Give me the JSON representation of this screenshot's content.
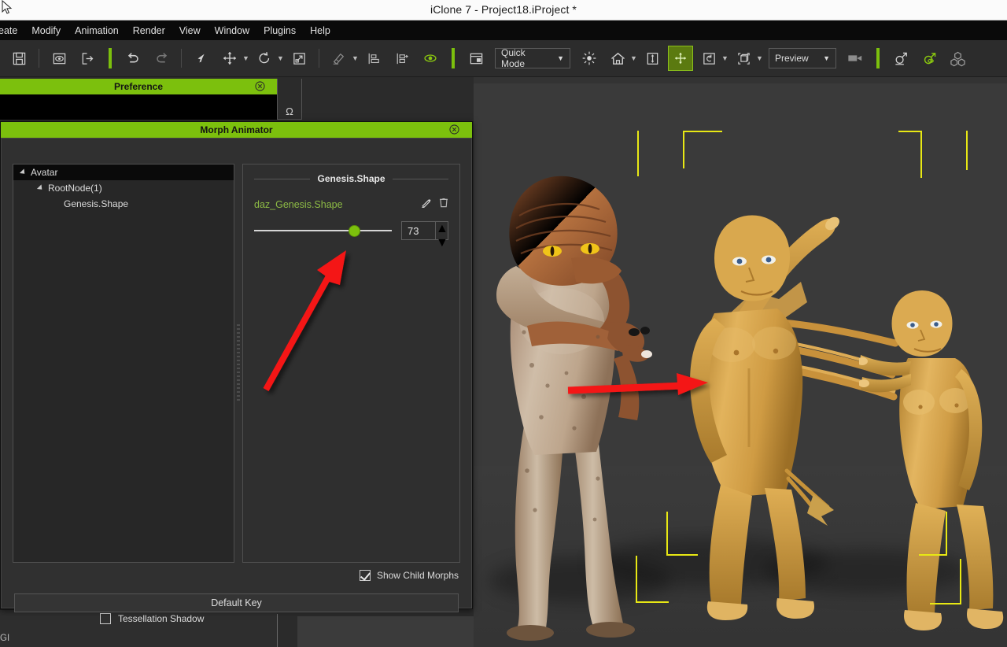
{
  "window": {
    "title": "iClone 7 - Project18.iProject *"
  },
  "menubar": {
    "items": [
      {
        "label": "eate"
      },
      {
        "label": "Modify"
      },
      {
        "label": "Animation"
      },
      {
        "label": "Render"
      },
      {
        "label": "View"
      },
      {
        "label": "Window"
      },
      {
        "label": "Plugins"
      },
      {
        "label": "Help"
      }
    ]
  },
  "toolbar": {
    "groups": [
      {
        "buttons": [
          {
            "icon": "save-icon",
            "name": "save-button"
          }
        ]
      },
      {
        "buttons": [
          {
            "icon": "preview-render-icon",
            "name": "preview-render-button"
          },
          {
            "icon": "export-icon",
            "name": "export-button"
          }
        ]
      },
      {
        "buttons": [
          {
            "icon": "undo-icon",
            "name": "undo-button"
          },
          {
            "icon": "redo-icon",
            "name": "redo-button"
          }
        ]
      },
      {
        "buttons": [
          {
            "icon": "select-arrow-icon",
            "name": "select-tool-button"
          },
          {
            "icon": "move-icon",
            "name": "move-tool-button",
            "caret": true
          },
          {
            "icon": "rotate-icon",
            "name": "rotate-tool-button",
            "caret": true
          },
          {
            "icon": "scale-icon",
            "name": "scale-tool-button"
          }
        ]
      },
      {
        "buttons": [
          {
            "icon": "edit-motion-icon",
            "name": "edit-motion-button",
            "caret": true
          },
          {
            "icon": "align-bottom-icon",
            "name": "align-button"
          },
          {
            "icon": "align-transfer-icon",
            "name": "transfer-button"
          },
          {
            "icon": "eye-icon",
            "name": "visibility-button"
          }
        ]
      },
      {
        "buttons": [
          {
            "icon": "layout-icon",
            "name": "layout-button"
          }
        ]
      }
    ],
    "quick_mode_label": "Quick Mode",
    "preview_label": "Preview",
    "right_buttons": [
      {
        "icon": "light-icon",
        "name": "light-button"
      },
      {
        "icon": "home-icon",
        "name": "home-button",
        "caret": true
      },
      {
        "icon": "ground-icon",
        "name": "ground-button"
      },
      {
        "icon": "move-grid-icon",
        "name": "move-grid-button",
        "active": true
      },
      {
        "icon": "physics-icon",
        "name": "physics-button",
        "caret": true
      },
      {
        "icon": "bounding-box-icon",
        "name": "bounding-box-button",
        "caret": true
      }
    ],
    "camera_icon": "camera-icon",
    "tail_buttons": [
      {
        "icon": "avatar-gender-icon",
        "name": "character-button"
      },
      {
        "icon": "morph-avatar-icon",
        "name": "morph-button"
      },
      {
        "icon": "props-cubes-icon",
        "name": "props-button"
      }
    ]
  },
  "preference_panel": {
    "title": "Preference",
    "close_icon": "close-circle-icon"
  },
  "side_strip": {
    "glyph": "Ω"
  },
  "morph_animator": {
    "title": "Morph Animator",
    "close_icon": "close-circle-icon",
    "tree": [
      {
        "label": "Avatar",
        "depth": 1,
        "expander": true,
        "selected": true
      },
      {
        "label": "RootNode(1)",
        "depth": 2,
        "expander": true,
        "selected": false
      },
      {
        "label": "Genesis.Shape",
        "depth": 3,
        "expander": false,
        "selected": false
      }
    ],
    "group_label": "Genesis.Shape",
    "morph": {
      "name": "daz_Genesis.Shape",
      "edit_icon": "pencil-icon",
      "delete_icon": "trash-icon",
      "value": "73",
      "slider_percent": 73,
      "spin_up": "▲",
      "spin_down": "▼"
    },
    "show_child_morphs": {
      "label": "Show Child Morphs",
      "checked": true
    },
    "default_key_label": "Default Key"
  },
  "lower_panel": {
    "tessellation_shadow": {
      "label": "Tessellation Shadow",
      "checked": false
    },
    "gi_label": "GI"
  },
  "viewport": {
    "background_color": "#3a3a3a",
    "selection_color": "#e8e814",
    "annotation_color": "#f41414",
    "figures": [
      {
        "name": "reptile-avatar",
        "tone": "#b08a6e"
      },
      {
        "name": "gold-male-avatar",
        "tone": "#d9a74e"
      },
      {
        "name": "gold-female-avatar",
        "tone": "#dcab58"
      }
    ],
    "annotations": [
      {
        "name": "arrow-to-slider",
        "direction": "up-right"
      },
      {
        "name": "arrow-to-avatar",
        "direction": "right"
      }
    ]
  },
  "colors": {
    "accent_green": "#7cc00d",
    "panel_bg": "#2f2f2f",
    "toolbar_bg": "#2c2c2c",
    "viewport_bg": "#3a3a3a",
    "selection_yellow": "#e8e814",
    "annotation_red": "#f41414",
    "morph_name_green": "#8dbb45"
  }
}
